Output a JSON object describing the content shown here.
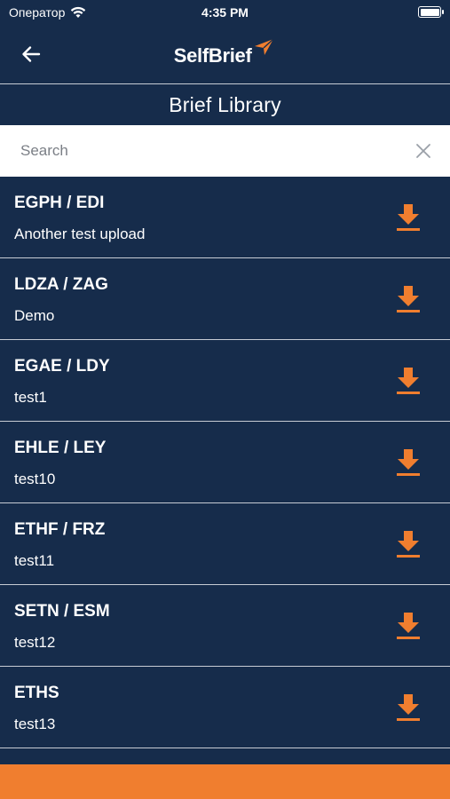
{
  "status": {
    "carrier": "Оператор",
    "time": "4:35 PM"
  },
  "header": {
    "logo_text": "SelfBrief",
    "title": "Brief Library"
  },
  "search": {
    "placeholder": "Search",
    "value": ""
  },
  "briefs": [
    {
      "route": "EGPH / EDI",
      "name": "Another test upload"
    },
    {
      "route": "LDZA / ZAG",
      "name": "Demo"
    },
    {
      "route": "EGAE / LDY",
      "name": "test1"
    },
    {
      "route": "EHLE / LEY",
      "name": "test10"
    },
    {
      "route": "ETHF / FRZ",
      "name": "test11"
    },
    {
      "route": "SETN / ESM",
      "name": "test12"
    },
    {
      "route": "ETHS",
      "name": "test13"
    }
  ],
  "colors": {
    "background": "#162c4b",
    "accent": "#f07e2f",
    "divider": "#c7ccd4"
  },
  "icons": [
    "back-arrow-icon",
    "logo-mark-icon",
    "wifi-icon",
    "battery-icon",
    "clear-icon",
    "download-icon"
  ]
}
